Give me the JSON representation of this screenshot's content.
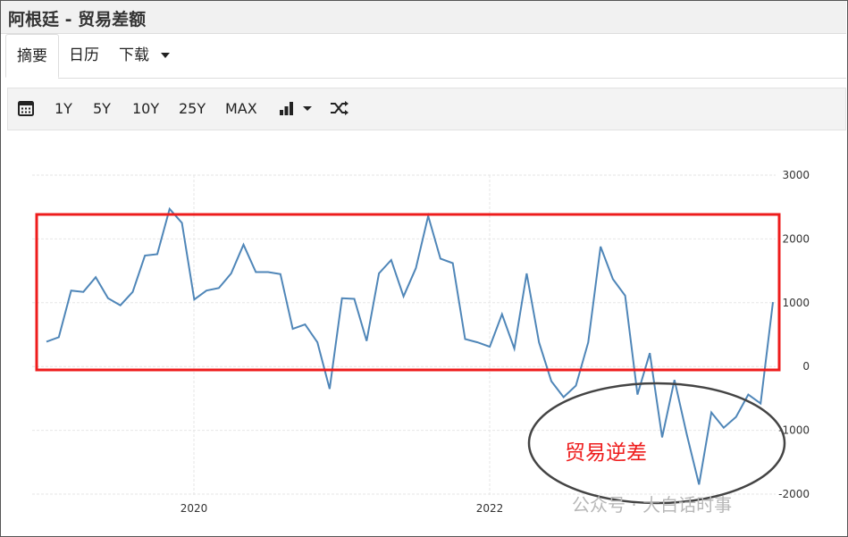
{
  "window": {
    "title": "阿根廷 - 贸易差额"
  },
  "tabs": [
    {
      "label": "摘要",
      "active": true
    },
    {
      "label": "日历",
      "active": false
    },
    {
      "label": "下载",
      "active": false,
      "has_dropdown": true
    }
  ],
  "toolbar": {
    "calendar_icon": "calendar-icon",
    "ranges": [
      "1Y",
      "5Y",
      "10Y",
      "25Y",
      "MAX"
    ],
    "chart_type_icon": "bar-chart-icon",
    "shuffle_icon": "shuffle-icon"
  },
  "annotation": {
    "label": "贸易逆差",
    "box_color": "#ee1c1c",
    "ellipse_color": "#444444"
  },
  "watermark": {
    "text": "公众号 · 大白话时事"
  },
  "chart_data": {
    "type": "line",
    "title": "",
    "xlabel": "",
    "ylabel": "",
    "series": [
      {
        "color": "#4f86b8",
        "values": [
          390,
          460,
          1190,
          1170,
          1400,
          1070,
          960,
          1170,
          1740,
          1760,
          2470,
          2250,
          1050,
          1190,
          1230,
          1460,
          1910,
          1480,
          1480,
          1450,
          590,
          660,
          380,
          -350,
          1070,
          1060,
          400,
          1460,
          1670,
          1100,
          1540,
          2360,
          1690,
          1620,
          430,
          380,
          310,
          820,
          280,
          1460,
          380,
          -230,
          -480,
          -300,
          380,
          1880,
          1370,
          1110,
          -440,
          210,
          -1110,
          -210,
          -1060,
          -1850,
          -720,
          -960,
          -790,
          -440,
          -580,
          1010
        ]
      }
    ],
    "x_ticks": [
      "2020",
      "2022"
    ],
    "y_ticks": [
      3000,
      2000,
      1000,
      0,
      -1000,
      -2000
    ],
    "ylim": [
      -2000,
      3000
    ],
    "y_axis_position": "right",
    "grid": true
  }
}
